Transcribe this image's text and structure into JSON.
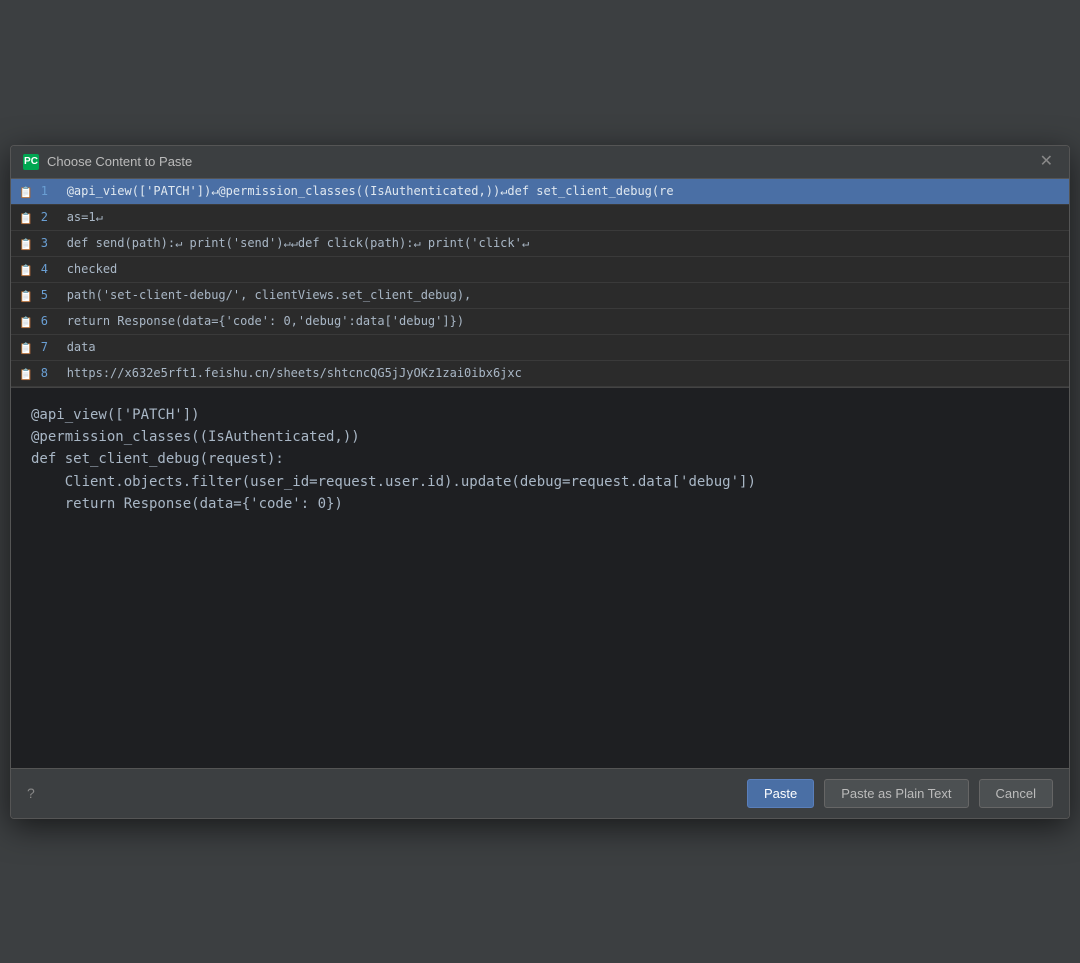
{
  "dialog": {
    "title": "Choose Content to Paste",
    "icon_label": "PC"
  },
  "clipboard_items": [
    {
      "num": "1",
      "text": "@api_view(['PATCH'])↵@permission_classes((IsAuthenticated,))↵def set_client_debug(re",
      "selected": true
    },
    {
      "num": "2",
      "text": "as=1↵",
      "selected": false
    },
    {
      "num": "3",
      "text": "def send(path):↵    print('send')↵↵def click(path):↵    print('click'↵",
      "selected": false
    },
    {
      "num": "4",
      "text": "checked",
      "selected": false
    },
    {
      "num": "5",
      "text": "path('set-client-debug/', clientViews.set_client_debug),",
      "selected": false
    },
    {
      "num": "6",
      "text": "return Response(data={'code': 0,'debug':data['debug']})",
      "selected": false
    },
    {
      "num": "7",
      "text": "data",
      "selected": false
    },
    {
      "num": "8",
      "text": "https://x632e5rft1.feishu.cn/sheets/shtcncQG5jJyOKz1zai0ibx6jxc",
      "selected": false
    }
  ],
  "preview": {
    "lines": [
      "@api_view(['PATCH'])",
      "@permission_classes((IsAuthenticated,))",
      "def set_client_debug(request):",
      "    Client.objects.filter(user_id=request.user.id).update(debug=request.data['debug'])",
      "    return Response(data={'code': 0})"
    ]
  },
  "footer": {
    "help_icon": "?",
    "paste_label": "Paste",
    "paste_plain_label": "Paste as Plain Text",
    "cancel_label": "Cancel"
  }
}
